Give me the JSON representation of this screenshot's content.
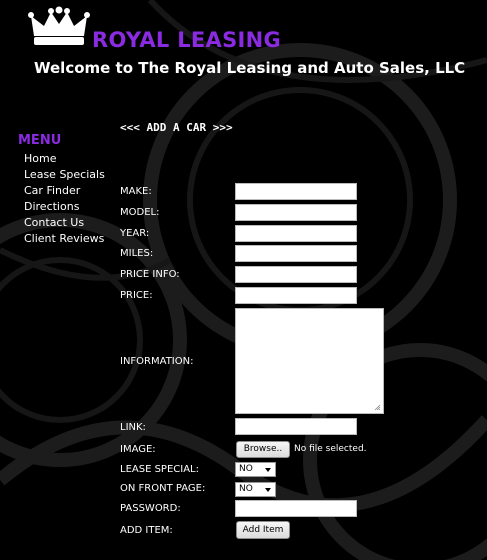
{
  "header": {
    "brand": "ROYAL LEASING",
    "welcome": "Welcome to The Royal Leasing and Auto Sales, LLC",
    "logo_icon": "crown-icon"
  },
  "menu": {
    "title": "MENU",
    "items": [
      {
        "label": "Home"
      },
      {
        "label": "Lease Specials"
      },
      {
        "label": "Car Finder"
      },
      {
        "label": "Directions"
      },
      {
        "label": "Contact Us"
      },
      {
        "label": "Client Reviews"
      }
    ]
  },
  "form": {
    "heading": "<<< ADD A CAR >>>",
    "make_label": "MAKE:",
    "model_label": "MODEL:",
    "year_label": "YEAR:",
    "miles_label": "MILES:",
    "price_info_label": "PRICE INFO:",
    "price_label": "PRICE:",
    "information_label": "INFORMATION:",
    "link_label": "LINK:",
    "image_label": "IMAGE:",
    "browse_button": "Browse..",
    "file_status": "No file selected.",
    "lease_special_label": "LEASE SPECIAL:",
    "lease_special_value": "NO",
    "front_page_label": "ON FRONT PAGE:",
    "front_page_value": "NO",
    "password_label": "PASSWORD:",
    "add_item_label": "ADD ITEM:",
    "add_item_button": "Add Item"
  },
  "colors": {
    "background": "#000000",
    "brand": "#8a2be2",
    "text": "#ffffff"
  }
}
